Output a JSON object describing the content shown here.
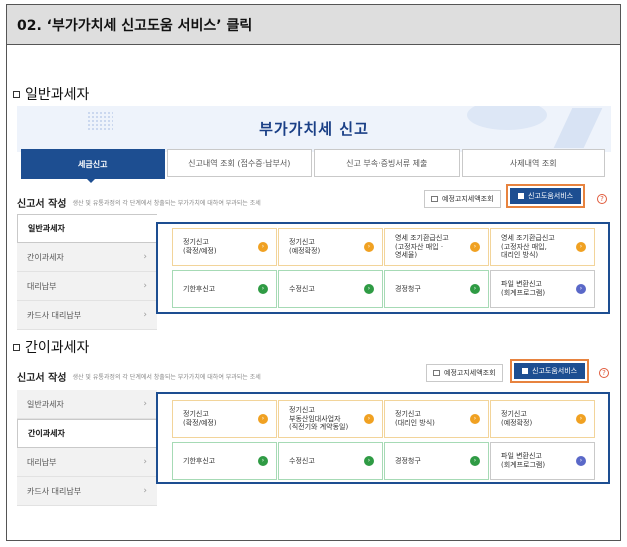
{
  "header": {
    "title": "02. ‘부가가치세 신고도움 서비스’ 클릭"
  },
  "sections": [
    {
      "label": "일반과세자"
    },
    {
      "label": "간이과세자"
    }
  ],
  "banner": {
    "title": "부가가치세 신고"
  },
  "tabs": [
    {
      "label": "세금신고",
      "active": true
    },
    {
      "label": "신고내역 조회 (접수증·납부서)"
    },
    {
      "label": "신고 부속·증빙서류 제출"
    },
    {
      "label": "사제내역 조회"
    }
  ],
  "panel1": {
    "write_title": "신고서 작성",
    "write_desc": "생산 및 유통과정의 각 단계에서 창출되는 부가가치에 대하여 부과되는 조세",
    "inquiry_button": "예정고지세액조회",
    "help_button": "신고도움서비스",
    "help_mark": "?",
    "side": [
      "일반과세자",
      "간이과세자",
      "대리납부",
      "카드사 대리납부"
    ],
    "active_side": 0,
    "cards": [
      {
        "label": "정기신고\n(확정/예정)",
        "color": "orange"
      },
      {
        "label": "정기신고\n(예정확정)",
        "color": "orange"
      },
      {
        "label": "영세 조기환급신고\n(고정자산 매입 ·\n영세율)",
        "color": "orange"
      },
      {
        "label": "영세 조기환급신고\n(고정자산 매입,\n대리인 방식)",
        "color": "orange"
      },
      {
        "label": "기한후신고",
        "color": "green"
      },
      {
        "label": "수정신고",
        "color": "green"
      },
      {
        "label": "경정청구",
        "color": "green"
      },
      {
        "label": "파일 변환신고\n(회계프로그램)",
        "color": "blue"
      }
    ]
  },
  "panel2": {
    "write_title": "신고서 작성",
    "write_desc": "생산 및 유통과정의 각 단계에서 창출되는 부가가치에 대하여 부과되는 조세",
    "inquiry_button": "예정고지세액조회",
    "help_button": "신고도움서비스",
    "help_mark": "?",
    "side": [
      "일반과세자",
      "간이과세자",
      "대리납부",
      "카드사 대리납부"
    ],
    "active_side": 1,
    "cards": [
      {
        "label": "정기신고\n(확정/예정)",
        "color": "orange"
      },
      {
        "label": "정기신고\n부동산임대사업자\n(직전기와 계약동일)",
        "color": "orange"
      },
      {
        "label": "정기신고\n(대리인 방식)",
        "color": "orange"
      },
      {
        "label": "정기신고\n(예정확정)",
        "color": "orange"
      },
      {
        "label": "기한후신고",
        "color": "green"
      },
      {
        "label": "수정신고",
        "color": "green"
      },
      {
        "label": "경정청구",
        "color": "green"
      },
      {
        "label": "파일 변환신고\n(회계프로그램)",
        "color": "blue"
      }
    ]
  },
  "icons": {
    "arrow": "›",
    "chevron": "›"
  },
  "colors": {
    "brand": "#1d4e91",
    "highlight": "#e7833f",
    "orange": "#f0a122",
    "green": "#2f9b44",
    "blue": "#5a68c8"
  }
}
